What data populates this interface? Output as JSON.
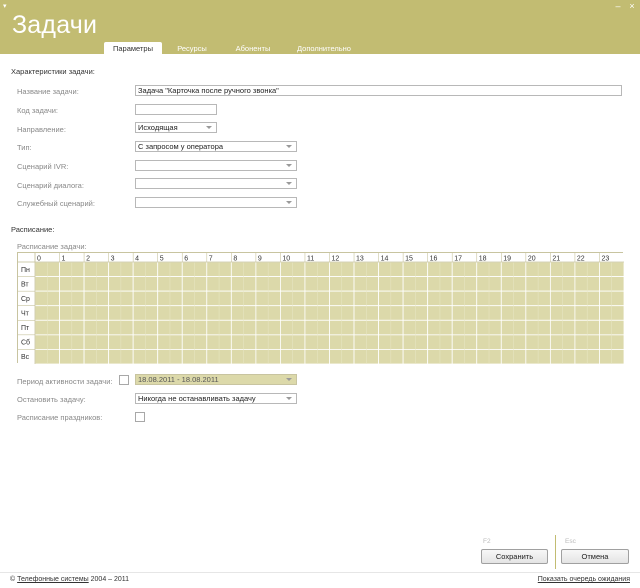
{
  "window": {
    "title": "Задачи",
    "system_icon": "▾",
    "buttons": [
      "–",
      "×"
    ]
  },
  "tabs": [
    {
      "label": "Параметры",
      "active": true
    },
    {
      "label": "Ресурсы",
      "active": false
    },
    {
      "label": "Абоненты",
      "active": false
    },
    {
      "label": "Дополнительно",
      "active": false
    }
  ],
  "task": {
    "section_title": "Характеристики задачи:",
    "name_label": "Название задачи:",
    "name_value": "Задача \"Карточка после ручного звонка\"",
    "code_label": "Код задачи:",
    "code_value": "",
    "direction_label": "Направление:",
    "direction_value": "Исходящая",
    "type_label": "Тип:",
    "type_value": "С запросом у оператора",
    "ivr_label": "Сценарий IVR:",
    "ivr_value": "",
    "dialog_label": "Сценарий диалога:",
    "dialog_value": "",
    "service_label": "Служебный сценарий:",
    "service_value": ""
  },
  "schedule": {
    "section_title": "Расписание:",
    "grid_label": "Расписание задачи:",
    "hours": [
      "0",
      "1",
      "2",
      "3",
      "4",
      "5",
      "6",
      "7",
      "8",
      "9",
      "10",
      "11",
      "12",
      "13",
      "14",
      "15",
      "16",
      "17",
      "18",
      "19",
      "20",
      "21",
      "22",
      "23"
    ],
    "days": [
      "Пн",
      "Вт",
      "Ср",
      "Чт",
      "Пт",
      "Сб",
      "Вс"
    ],
    "active_period_label": "Период активности задачи:",
    "active_period_checked": false,
    "active_period_value": "18.08.2011 - 18.08.2011",
    "stop_label": "Остановить задачу:",
    "stop_value": "Никогда не останавливать задачу",
    "holidays_label": "Расписание праздников:",
    "holidays_checked": false
  },
  "footer": {
    "save_key": "F2",
    "save_label": "Сохранить",
    "cancel_key": "Esc",
    "cancel_label": "Отмена"
  },
  "status": {
    "copyright_symbol": "©",
    "company_link": "Телефонные системы",
    "years": "2004 – 2011",
    "queue_link": "Показать очередь ожидания"
  },
  "colors": {
    "accent": "#c2bc72",
    "grid_cell": "#dcd9aa"
  }
}
